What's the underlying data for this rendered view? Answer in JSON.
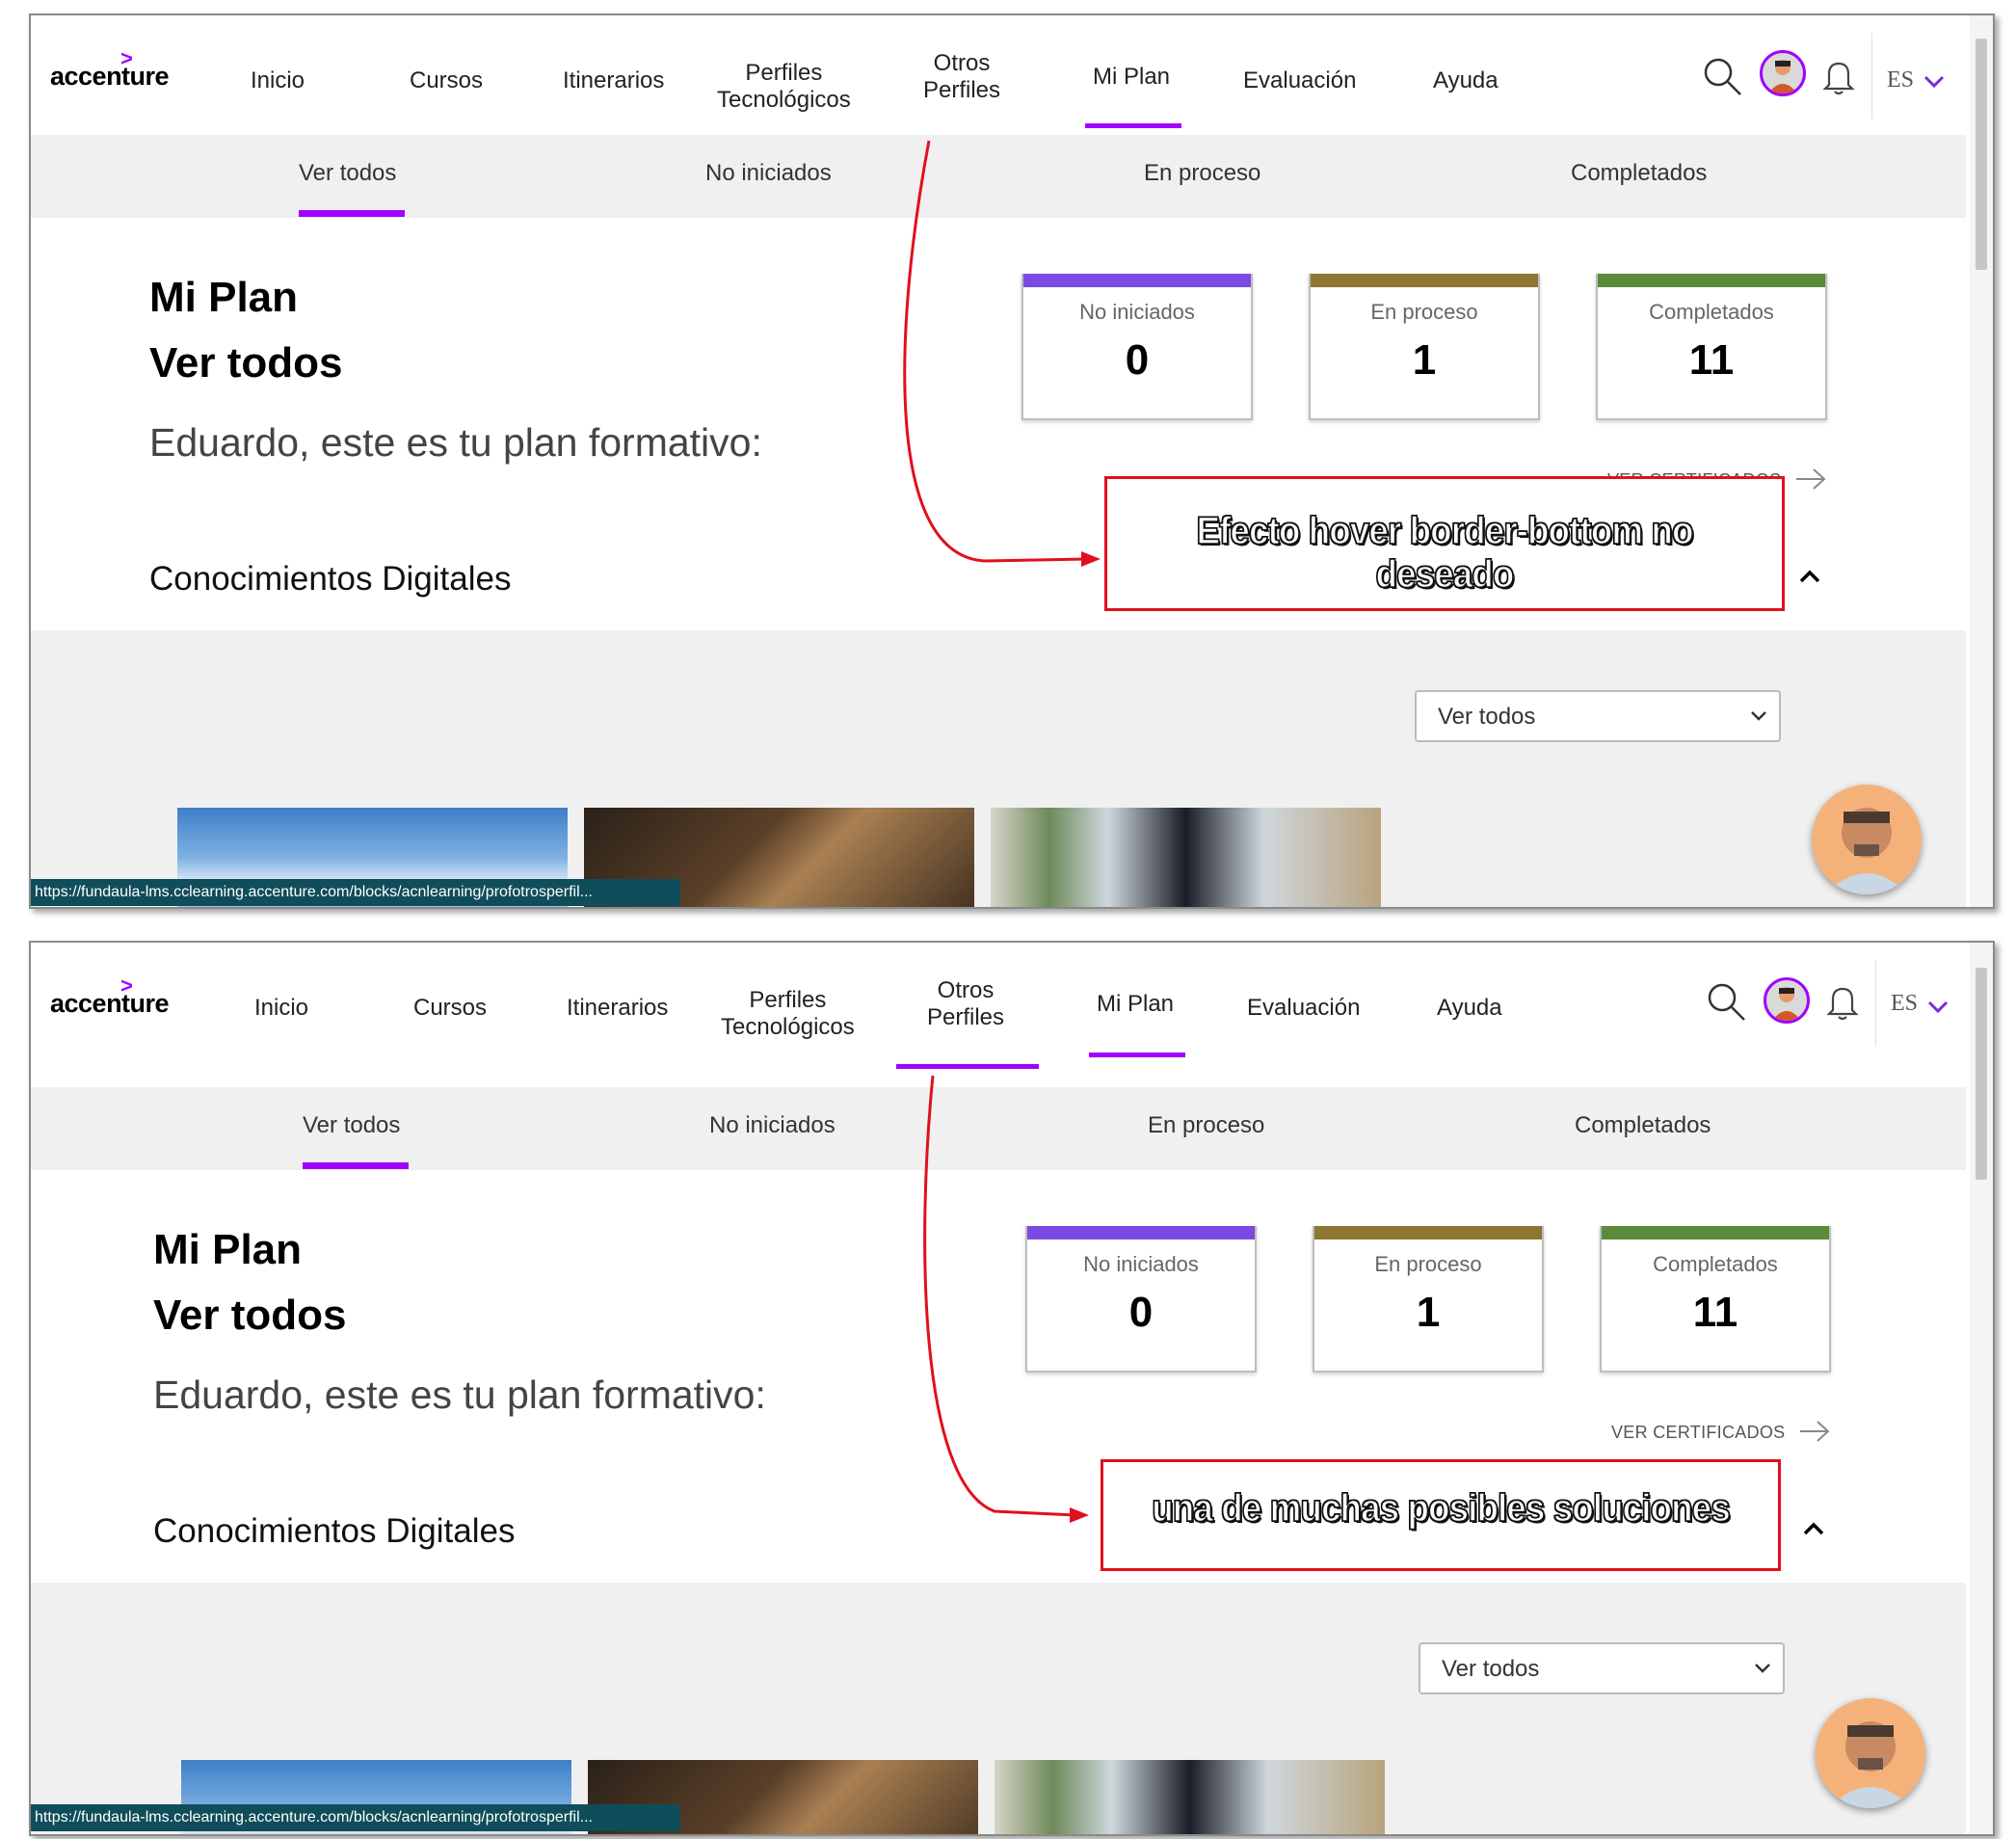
{
  "panels": [
    {
      "logo": "accenture",
      "nav": [
        "Inicio",
        "Cursos",
        "Itinerarios",
        "Perfiles\nTecnológicos",
        "Otros\nPerfiles",
        "Mi Plan",
        "Evaluación",
        "Ayuda"
      ],
      "lang": "ES",
      "subnav": [
        "Ver todos",
        "No iniciados",
        "En proceso",
        "Completados"
      ],
      "title1": "Mi Plan",
      "title2": "Ver todos",
      "greeting": "Eduardo, este es tu plan formativo:",
      "section": "Conocimientos Digitales",
      "cards": [
        {
          "label": "No iniciados",
          "value": "0",
          "color": "#7b4ae2"
        },
        {
          "label": "En proceso",
          "value": "1",
          "color": "#8c7630"
        },
        {
          "label": "Completados",
          "value": "11",
          "color": "#5a8a3a"
        }
      ],
      "cert_link": "VER CERTIFICADOS",
      "select_value": "Ver todos",
      "status_url": "https://fundaula-lms.cclearning.accenture.com/blocks/acnlearning/profotrosperfil...",
      "annotation": "Efecto hover border-bottom no deseado"
    },
    {
      "logo": "accenture",
      "nav": [
        "Inicio",
        "Cursos",
        "Itinerarios",
        "Perfiles\nTecnológicos",
        "Otros\nPerfiles",
        "Mi Plan",
        "Evaluación",
        "Ayuda"
      ],
      "lang": "ES",
      "subnav": [
        "Ver todos",
        "No iniciados",
        "En proceso",
        "Completados"
      ],
      "title1": "Mi Plan",
      "title2": "Ver todos",
      "greeting": "Eduardo, este es tu plan formativo:",
      "section": "Conocimientos Digitales",
      "cards": [
        {
          "label": "No iniciados",
          "value": "0",
          "color": "#7b4ae2"
        },
        {
          "label": "En proceso",
          "value": "1",
          "color": "#8c7630"
        },
        {
          "label": "Completados",
          "value": "11",
          "color": "#5a8a3a"
        }
      ],
      "cert_link": "VER CERTIFICADOS",
      "select_value": "Ver todos",
      "status_url": "https://fundaula-lms.cclearning.accenture.com/blocks/acnlearning/profotrosperfil...",
      "annotation": "una de muchas posibles soluciones"
    }
  ],
  "icons": {
    "search": "search-icon",
    "bell": "bell-icon",
    "chevron": "chevron-down-icon",
    "arrow": "arrow-right-icon",
    "collapse": "chevron-up-icon"
  },
  "colors": {
    "accent": "#a100ff",
    "annotation": "#e0101c"
  }
}
